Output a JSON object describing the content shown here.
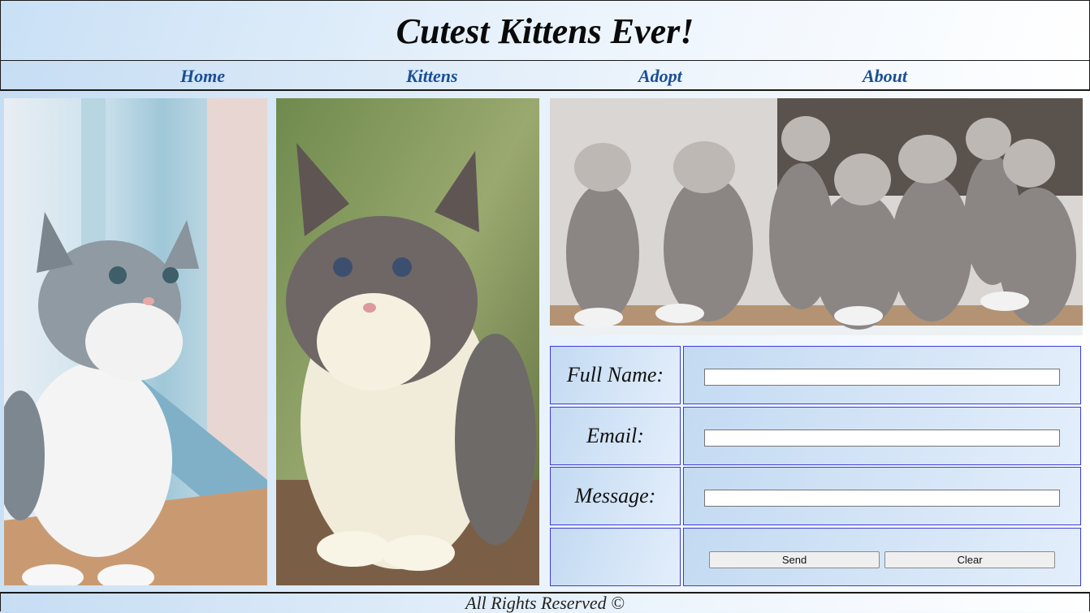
{
  "header": {
    "title": "Cutest Kittens Ever!"
  },
  "nav": {
    "items": [
      {
        "label": "Home"
      },
      {
        "label": "Kittens"
      },
      {
        "label": "Adopt"
      },
      {
        "label": "About"
      }
    ]
  },
  "form": {
    "full_name_label": "Full Name:",
    "full_name_value": "",
    "email_label": "Email:",
    "email_value": "",
    "message_label": "Message:",
    "message_value": "",
    "send_label": "Send",
    "clear_label": "Clear"
  },
  "footer": {
    "text": "All Rights Reserved ©"
  },
  "colors": {
    "nav_link": "#1b4e96",
    "form_border": "#3b3be0",
    "header_gradient_start": "#c9e0f5"
  }
}
